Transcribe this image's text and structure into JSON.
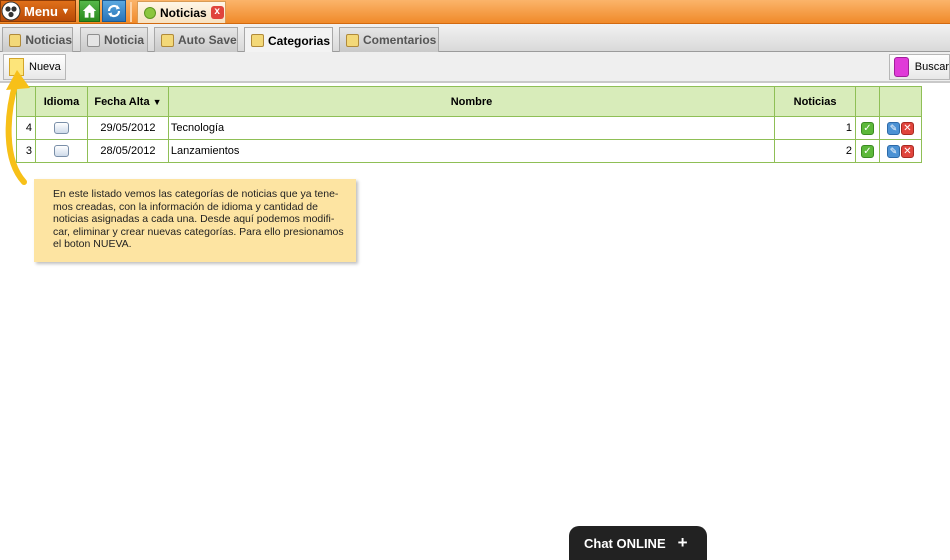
{
  "topbar": {
    "menu_label": "Menu",
    "app_tab_label": "Noticias",
    "app_tab_close": "x"
  },
  "tabs": [
    {
      "label": "Noticias",
      "active": false
    },
    {
      "label": "Noticia",
      "active": false
    },
    {
      "label": "Auto Save",
      "active": false
    },
    {
      "label": "Categorias",
      "active": true
    },
    {
      "label": "Comentarios",
      "active": false
    }
  ],
  "toolbar": {
    "new_label": "Nueva",
    "search_label": "Buscar"
  },
  "table": {
    "headers": {
      "idioma": "Idioma",
      "fecha_alta": "Fecha Alta",
      "nombre": "Nombre",
      "noticias": "Noticias"
    },
    "rows": [
      {
        "id": "4",
        "fecha": "29/05/2012",
        "nombre": "Tecnología",
        "noticias": "1"
      },
      {
        "id": "3",
        "fecha": "28/05/2012",
        "nombre": "Lanzamientos",
        "noticias": "2"
      }
    ]
  },
  "tooltip": {
    "lines": [
      "En este listado vemos las categorías de noticias que ya tene-",
      "mos creadas, con la información de idioma y cantidad de",
      "noticias asignadas a cada una. Desde aquí podemos modifi-",
      "car, eliminar y crear nuevas categorías. Para ello presionamos",
      "el boton NUEVA."
    ]
  },
  "chat": {
    "label": "Chat ONLINE",
    "plus": "+"
  },
  "colors": {
    "accent_orange": "#f08a2a",
    "table_header_bg": "#d8ecba",
    "table_border": "#8fbf56",
    "tooltip_bg": "#fde4a2",
    "arrow": "#f7c018"
  }
}
